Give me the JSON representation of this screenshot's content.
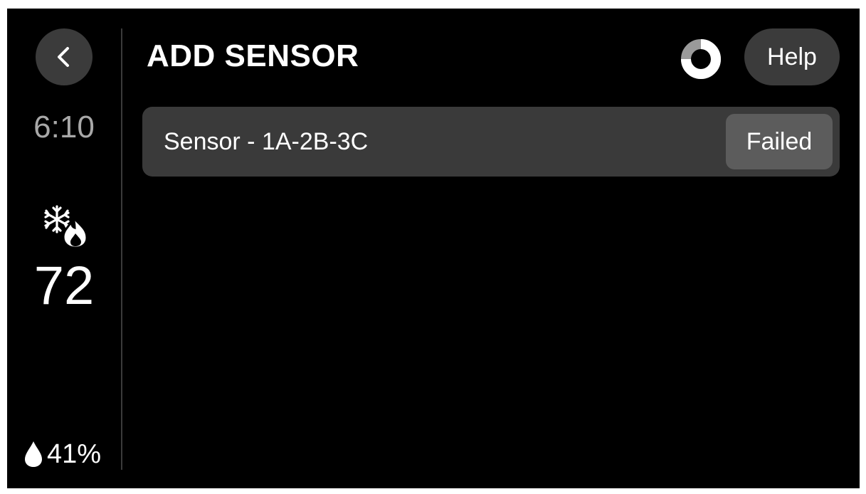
{
  "sidebar": {
    "back_icon": "chevron-left-icon",
    "time": "6:10",
    "mode_icon": "heat-cool-icon",
    "temperature": "72",
    "humidity_icon": "water-drop-icon",
    "humidity": "41%"
  },
  "header": {
    "title": "ADD SENSOR",
    "progress_icon": "progress-ring-icon",
    "help_label": "Help"
  },
  "sensors": [
    {
      "name": "Sensor - 1A-2B-3C",
      "status": "Failed"
    }
  ],
  "colors": {
    "background": "#000000",
    "button": "#3b3b3b",
    "row": "#3a3a3a",
    "badge": "#5c5c5c",
    "muted_text": "#a8a8a8",
    "text": "#ffffff"
  }
}
